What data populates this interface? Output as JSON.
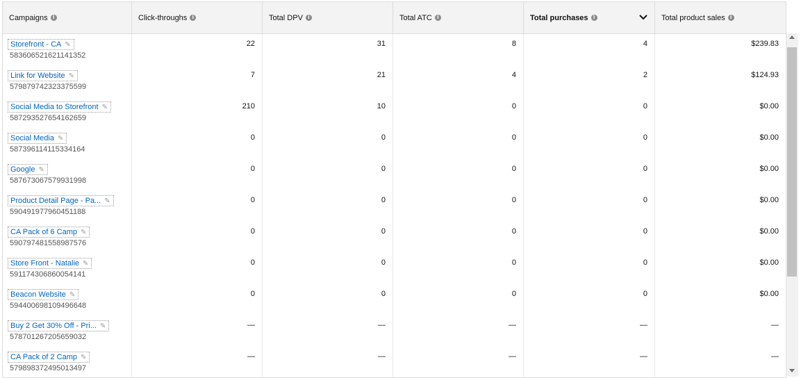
{
  "header": {
    "campaigns": "Campaigns",
    "click_throughs": "Click-throughs",
    "total_dpv": "Total DPV",
    "total_atc": "Total ATC",
    "total_purchases": "Total purchases",
    "total_product_sales": "Total product sales",
    "info_glyph": "i"
  },
  "pencil_glyph": "✎",
  "rows": [
    {
      "name": "Storefront - CA",
      "id": "583606521621141352",
      "clicks": "22",
      "dpv": "31",
      "atc": "8",
      "purchases": "4",
      "sales": "$239.83"
    },
    {
      "name": "Link for Website",
      "id": "579879742323375599",
      "clicks": "7",
      "dpv": "21",
      "atc": "4",
      "purchases": "2",
      "sales": "$124.93"
    },
    {
      "name": "Social Media to Storefront",
      "id": "587293527654162659",
      "clicks": "210",
      "dpv": "10",
      "atc": "0",
      "purchases": "0",
      "sales": "$0.00"
    },
    {
      "name": "Social Media",
      "id": "587396114115334164",
      "clicks": "0",
      "dpv": "0",
      "atc": "0",
      "purchases": "0",
      "sales": "$0.00"
    },
    {
      "name": "Google",
      "id": "587673067579931998",
      "clicks": "0",
      "dpv": "0",
      "atc": "0",
      "purchases": "0",
      "sales": "$0.00"
    },
    {
      "name": "Product Detail Page - Pa...",
      "id": "590491977960451188",
      "clicks": "0",
      "dpv": "0",
      "atc": "0",
      "purchases": "0",
      "sales": "$0.00"
    },
    {
      "name": "CA Pack of 6 Camp",
      "id": "590797481558987576",
      "clicks": "0",
      "dpv": "0",
      "atc": "0",
      "purchases": "0",
      "sales": "$0.00"
    },
    {
      "name": "Store Front - Natalie",
      "id": "591174306860054141",
      "clicks": "0",
      "dpv": "0",
      "atc": "0",
      "purchases": "0",
      "sales": "$0.00"
    },
    {
      "name": "Beacon Website",
      "id": "594400698109496648",
      "clicks": "0",
      "dpv": "0",
      "atc": "0",
      "purchases": "0",
      "sales": "$0.00"
    },
    {
      "name": "Buy 2 Get 30% Off - Pri...",
      "id": "578701267205659032",
      "clicks": "—",
      "dpv": "—",
      "atc": "—",
      "purchases": "—",
      "sales": "—"
    },
    {
      "name": "CA Pack of 2 Camp",
      "id": "579898372495013497",
      "clicks": "—",
      "dpv": "—",
      "atc": "—",
      "purchases": "—",
      "sales": "—"
    }
  ]
}
